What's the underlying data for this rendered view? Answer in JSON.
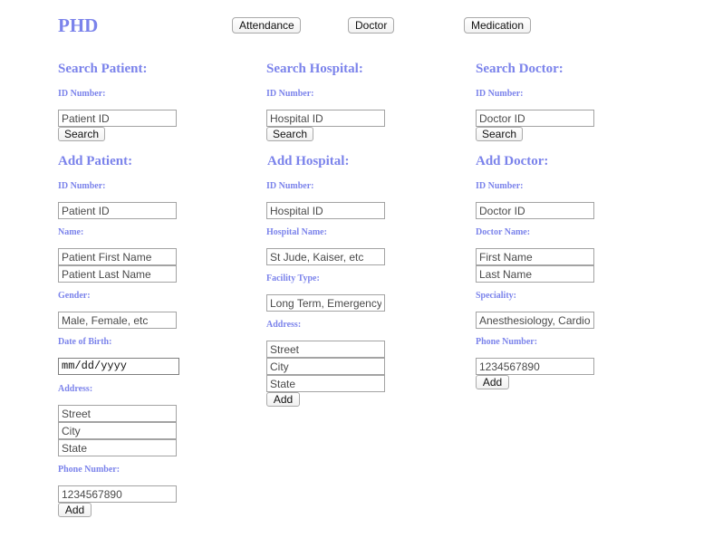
{
  "brand": {
    "title": "PHD"
  },
  "nav": {
    "attendance_label": "Attendance",
    "doctor_label": "Doctor",
    "medication_label": "Medication"
  },
  "search_patient": {
    "title": "Search Patient:",
    "id_label": "ID Number:",
    "id_placeholder": "Patient ID",
    "button_label": "Search"
  },
  "search_hospital": {
    "title": "Search Hospital:",
    "id_label": "ID Number:",
    "id_placeholder": "Hospital ID",
    "button_label": "Search"
  },
  "search_doctor": {
    "title": "Search Doctor:",
    "id_label": "ID Number:",
    "id_placeholder": "Doctor ID",
    "button_label": "Search"
  },
  "add_patient": {
    "title": "Add Patient:",
    "id_label": "ID Number:",
    "id_placeholder": "Patient ID",
    "name_label": "Name:",
    "first_name_placeholder": "Patient First Name",
    "last_name_placeholder": "Patient Last Name",
    "gender_label": "Gender:",
    "gender_placeholder": "Male, Female, etc",
    "dob_label": "Date of Birth:",
    "dob_value": "mm/dd/yyyy",
    "address_label": "Address:",
    "street_placeholder": "Street",
    "city_placeholder": "City",
    "state_placeholder": "State",
    "phone_label": "Phone Number:",
    "phone_placeholder": "1234567890",
    "button_label": "Add"
  },
  "add_hospital": {
    "title": "Add Hospital:",
    "id_label": "ID Number:",
    "id_placeholder": "Hospital ID",
    "name_label": "Hospital Name:",
    "name_placeholder": "St Jude, Kaiser, etc",
    "facility_label": "Facility Type:",
    "facility_placeholder": "Long Term, Emergency",
    "address_label": "Address:",
    "street_placeholder": "Street",
    "city_placeholder": "City",
    "state_placeholder": "State",
    "button_label": "Add"
  },
  "add_doctor": {
    "title": "Add Doctor:",
    "id_label": "ID Number:",
    "id_placeholder": "Doctor ID",
    "name_label": "Doctor Name:",
    "first_name_placeholder": "First Name",
    "last_name_placeholder": "Last Name",
    "speciality_label": "Speciality:",
    "speciality_placeholder": "Anesthesiology, Cardiology",
    "phone_label": "Phone Number:",
    "phone_placeholder": "1234567890",
    "button_label": "Add"
  }
}
